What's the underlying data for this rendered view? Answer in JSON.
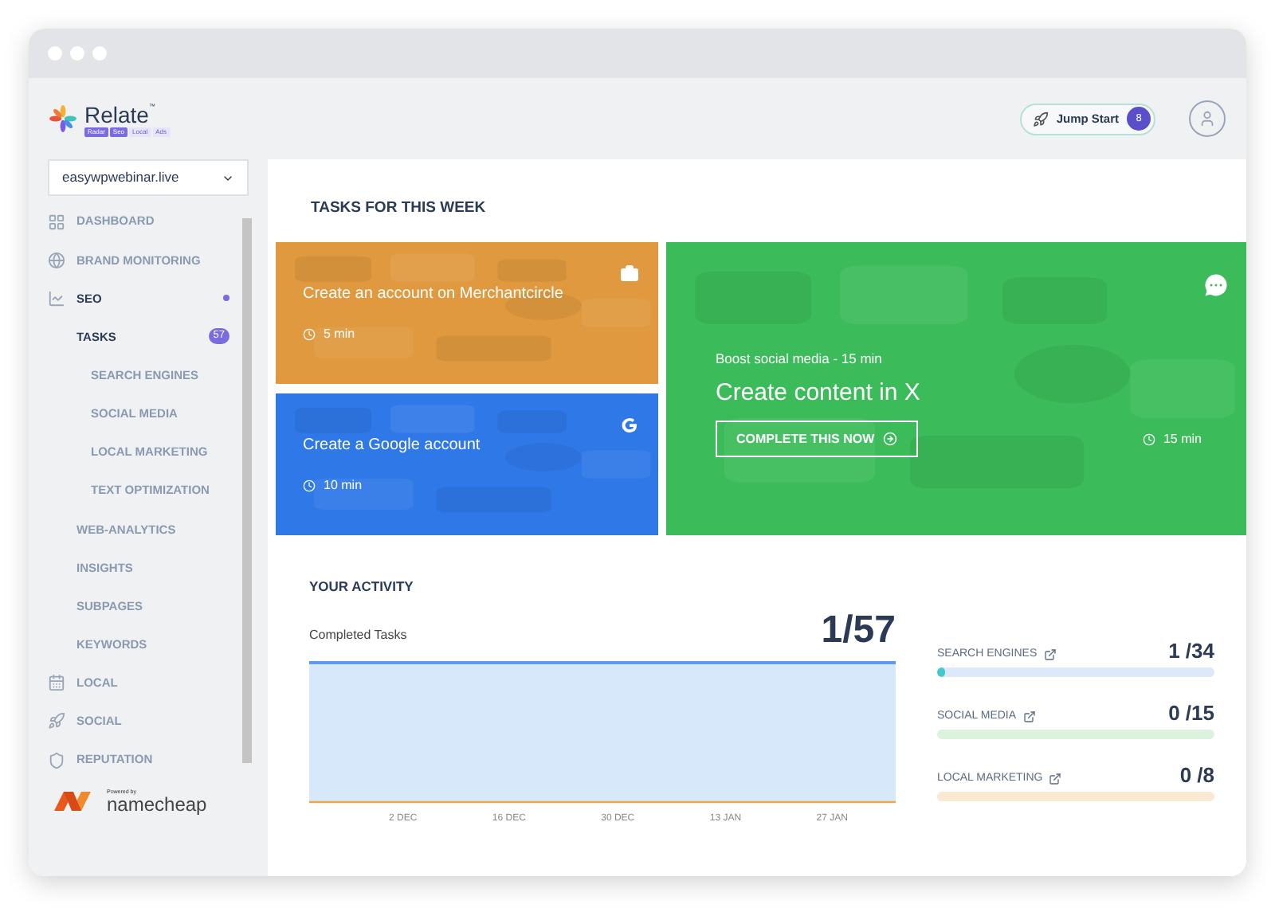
{
  "brand": {
    "name": "Relate",
    "tm": "™",
    "products": [
      {
        "label": "Radar",
        "active": true
      },
      {
        "label": "Seo",
        "active": true
      },
      {
        "label": "Local",
        "active": false
      },
      {
        "label": "Ads",
        "active": false
      }
    ]
  },
  "header": {
    "jump_start": {
      "label": "Jump Start",
      "count": "8"
    }
  },
  "sidebar": {
    "site": "easywpwebinar.live",
    "items": [
      {
        "label": "DASHBOARD",
        "selected": false
      },
      {
        "label": "BRAND MONITORING",
        "selected": false
      },
      {
        "label": "SEO",
        "selected": false,
        "expanded": true,
        "children": [
          {
            "label": "TASKS",
            "selected": true,
            "badge": "57",
            "children": [
              {
                "label": "SEARCH ENGINES",
                "selected": false
              },
              {
                "label": "SOCIAL MEDIA",
                "selected": false
              },
              {
                "label": "LOCAL MARKETING",
                "selected": false
              },
              {
                "label": "TEXT OPTIMIZATION",
                "selected": false
              }
            ]
          },
          {
            "label": "WEB-ANALYTICS",
            "selected": false
          },
          {
            "label": "INSIGHTS",
            "selected": false
          },
          {
            "label": "SUBPAGES",
            "selected": false
          },
          {
            "label": "KEYWORDS",
            "selected": false
          }
        ]
      },
      {
        "label": "LOCAL",
        "selected": false
      },
      {
        "label": "SOCIAL",
        "selected": false
      },
      {
        "label": "REPUTATION",
        "selected": false
      }
    ],
    "powered_by": "Powered by",
    "partner": "namecheap"
  },
  "tasks": {
    "title": "TASKS FOR THIS WEEK",
    "cards": [
      {
        "kind": "small",
        "color": "#e0993f",
        "title": "Create an account on Merchantcircle",
        "time": "5 min"
      },
      {
        "kind": "small",
        "color": "#2f78e8",
        "title": "Create a Google account",
        "time": "10 min"
      },
      {
        "kind": "large",
        "color": "#3cbb5a",
        "subtitle": "Boost social media - 15 min",
        "title": "Create content in X",
        "button": "COMPLETE THIS NOW",
        "time": "15 min"
      }
    ]
  },
  "activity": {
    "title": "YOUR ACTIVITY",
    "label": "Completed Tasks",
    "total": "1/57",
    "x_labels": [
      "2 DEC",
      "16 DEC",
      "30 DEC",
      "13 JAN",
      "27 JAN"
    ],
    "stats": [
      {
        "label": "SEARCH ENGINES",
        "value": "1 /34",
        "level": 0.03,
        "color": "#dbe9fb"
      },
      {
        "label": "SOCIAL MEDIA",
        "value": "0 /15",
        "level": 0,
        "color": "#dcf2df"
      },
      {
        "label": "LOCAL MARKETING",
        "value": "0 /8",
        "level": 0,
        "color": "#fbe8d3"
      }
    ]
  }
}
